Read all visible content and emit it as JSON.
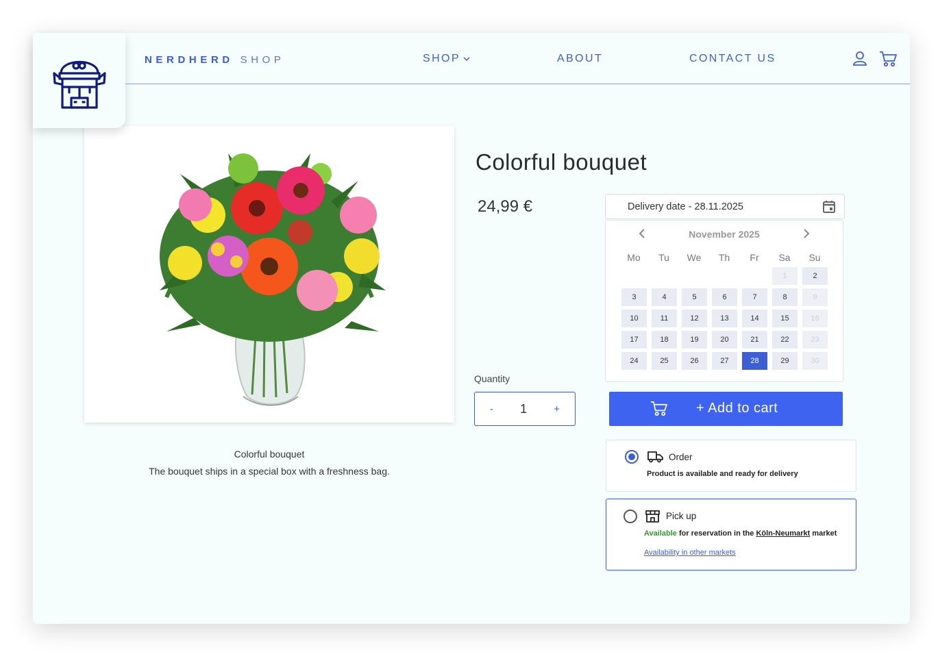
{
  "header": {
    "brand_bold": "NERDHERD",
    "brand_light": "SHOP",
    "nav": {
      "shop": "SHOP",
      "about": "ABOUT",
      "contact": "CONTACT US"
    },
    "icons": [
      "logo-bull-icon",
      "user-icon",
      "cart-icon",
      "chevron-down-icon"
    ]
  },
  "product": {
    "title": "Colorful bouquet",
    "price": "24,99 €",
    "caption_title": "Colorful bouquet",
    "caption_text": "The bouquet ships in a special box with a freshness bag."
  },
  "quantity": {
    "label": "Quantity",
    "value": "1",
    "minus": "-",
    "plus": "+"
  },
  "delivery": {
    "field_text": "Delivery date - 28.11.2025",
    "month_label": "November 2025",
    "weekdays": [
      "Mo",
      "Tu",
      "We",
      "Th",
      "Fr",
      "Sa",
      "Su"
    ],
    "weeks": [
      [
        "",
        "",
        "",
        "",
        "",
        "1",
        "2"
      ],
      [
        "3",
        "4",
        "5",
        "6",
        "7",
        "8",
        "9"
      ],
      [
        "10",
        "11",
        "12",
        "13",
        "14",
        "15",
        "16"
      ],
      [
        "17",
        "18",
        "19",
        "20",
        "21",
        "22",
        "23"
      ],
      [
        "24",
        "25",
        "26",
        "27",
        "28",
        "29",
        "30"
      ]
    ],
    "disabled_days": [
      "1",
      "9",
      "16",
      "23",
      "30"
    ],
    "selected_day": "28"
  },
  "cart": {
    "add_label": "+ Add to cart"
  },
  "options": {
    "order": {
      "title": "Order",
      "desc": "Product is available and ready for delivery",
      "checked": true
    },
    "pickup": {
      "title": "Pick up",
      "available": "Available",
      "desc_mid": " for reservation in the ",
      "market": "Köln-Neumarkt",
      "desc_end": " market",
      "link": "Availability in other markets",
      "checked": false
    }
  },
  "colors": {
    "accent": "#3e63f0",
    "nav": "#3d5fd4",
    "frame": "#f5fdfd",
    "available": "#2e9a2e"
  }
}
